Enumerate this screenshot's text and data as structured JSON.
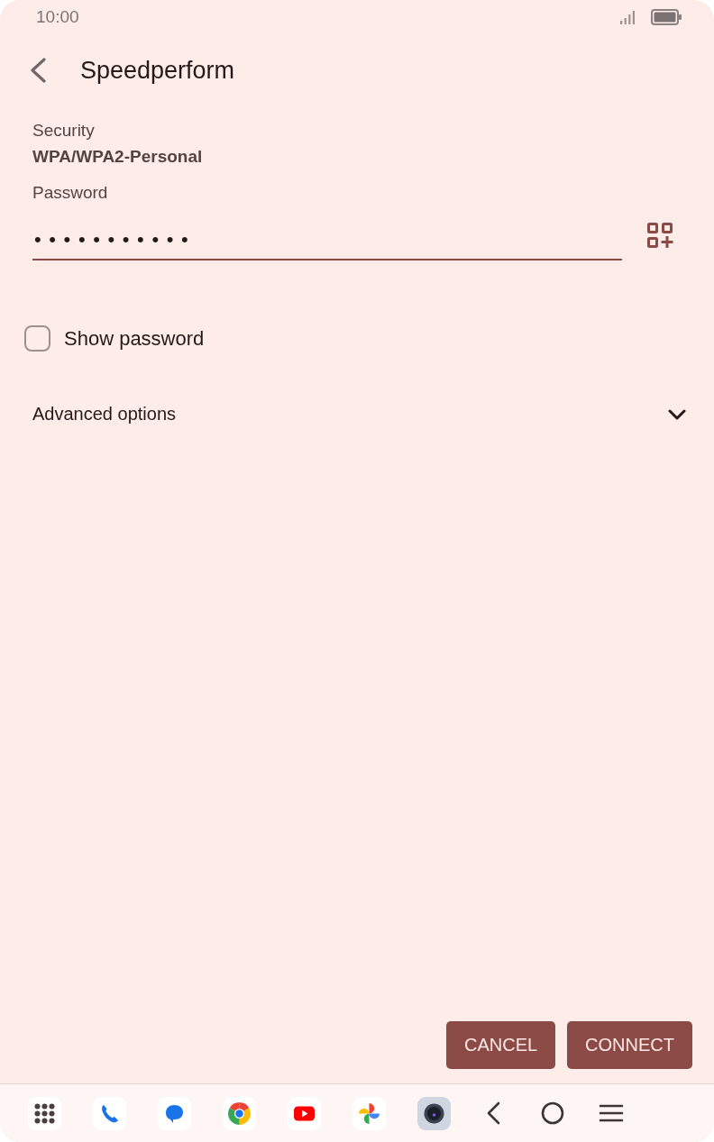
{
  "status_bar": {
    "time": "10:00"
  },
  "header": {
    "title": "Speedperform"
  },
  "security": {
    "label": "Security",
    "value": "WPA/WPA2-Personal"
  },
  "password": {
    "label": "Password",
    "value": "•••••••••••"
  },
  "show_password": {
    "label": "Show password",
    "checked": false
  },
  "advanced_options": {
    "label": "Advanced options",
    "expanded": false
  },
  "buttons": [
    {
      "label": "CANCEL"
    },
    {
      "label": "CONNECT"
    }
  ]
}
